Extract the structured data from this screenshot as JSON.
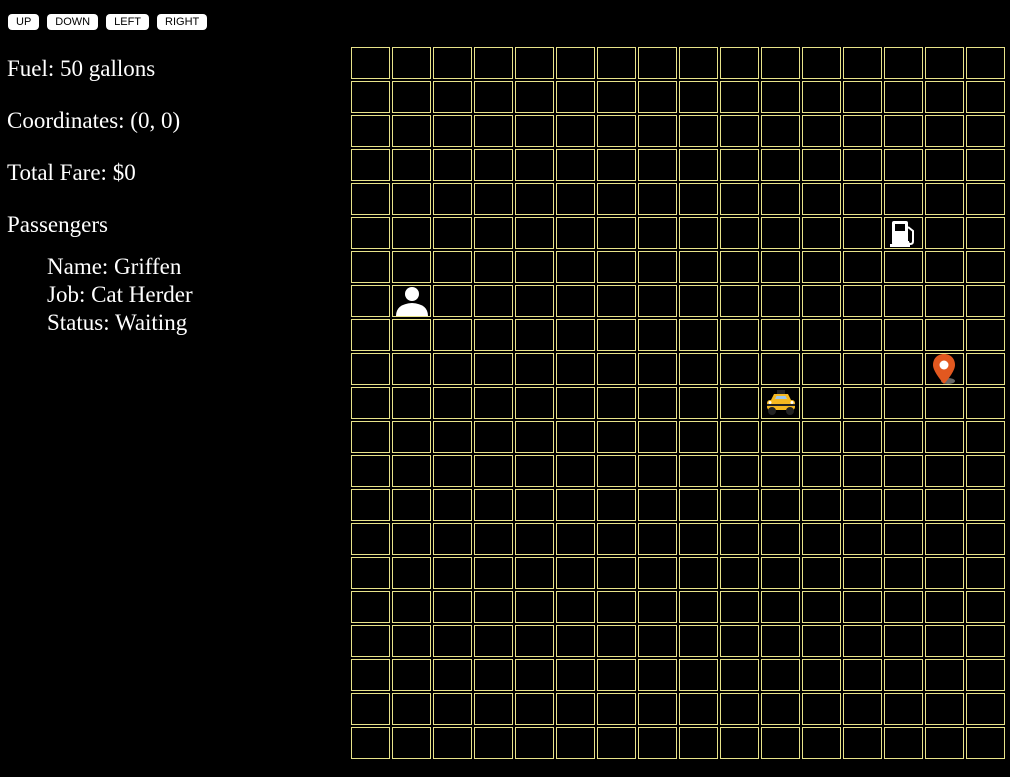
{
  "controls": {
    "up": "UP",
    "down": "DOWN",
    "left": "LEFT",
    "right": "RIGHT"
  },
  "status": {
    "fuel": "Fuel: 50 gallons",
    "coordinates": "Coordinates: (0, 0)",
    "total_fare": "Total Fare: $0",
    "passengers_heading": "Passengers"
  },
  "passenger": {
    "name": "Name: Griffen",
    "job": "Job: Cat Herder",
    "status": "Status: Waiting"
  },
  "map": {
    "cols": 16,
    "rows": 21,
    "tokens": [
      {
        "name": "gas-station-icon",
        "col": 13,
        "row": 5,
        "icon": "gas-pump-icon"
      },
      {
        "name": "passenger-icon",
        "col": 1,
        "row": 7,
        "icon": "person-icon"
      },
      {
        "name": "destination-marker-icon",
        "col": 14,
        "row": 9,
        "icon": "map-pin-icon"
      },
      {
        "name": "taxi-icon",
        "col": 10,
        "row": 10,
        "icon": "taxi-icon"
      }
    ],
    "colors": {
      "grid_border": "#e8e38a",
      "background": "#000000",
      "pin": "#e2581f",
      "taxi": "#f5b820"
    }
  }
}
